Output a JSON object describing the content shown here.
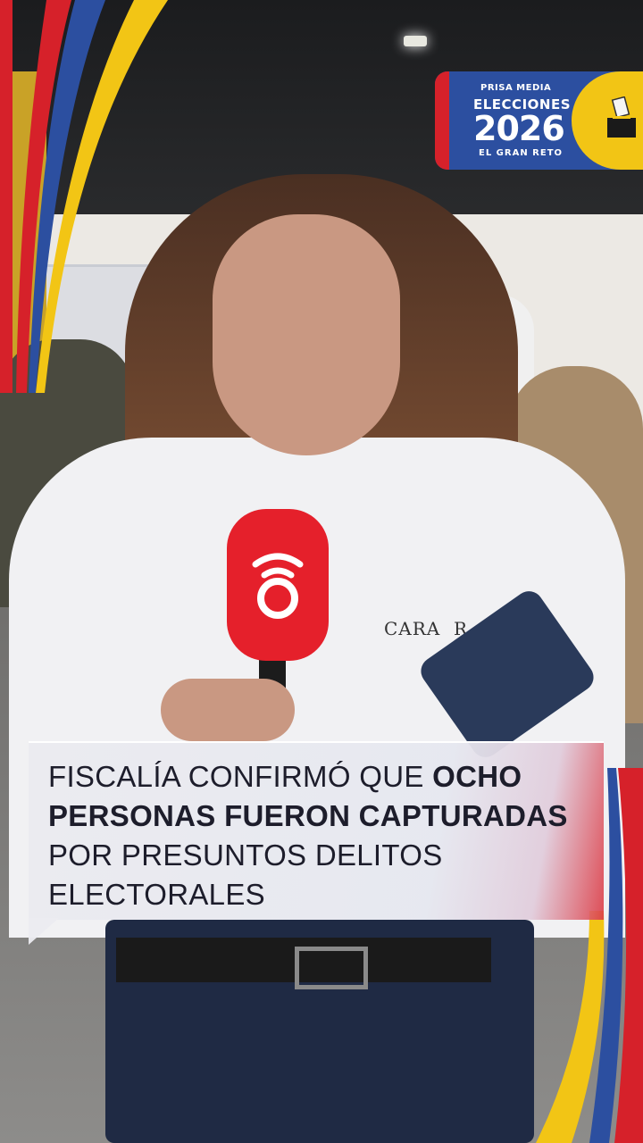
{
  "badge": {
    "brand": "PRISA MEDIA",
    "title": "ELECCIONES",
    "year": "2026",
    "subtitle": "EL GRAN RETO"
  },
  "microphone": {
    "logo_icon": "caracol-radio-logo-icon"
  },
  "shirt": {
    "logo_text": "CARA  R"
  },
  "caption": {
    "part1": "FISCALÍA CONFIRMÓ QUE ",
    "part2": "OCHO PERSONAS FUERON CAPTURADAS",
    "part3": " POR PRESUNTOS DELITOS ELECTORALES"
  },
  "colors": {
    "flag_yellow": "#f2c515",
    "flag_blue": "#2c4fa0",
    "flag_red": "#d6212a",
    "mic_red": "#e5202b"
  }
}
